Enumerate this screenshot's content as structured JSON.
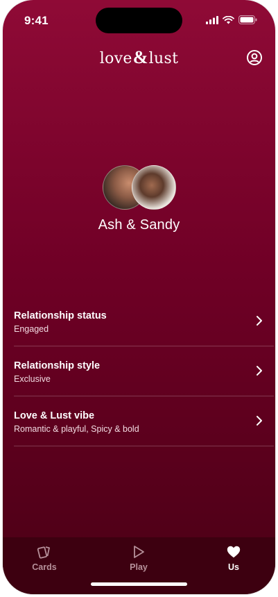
{
  "status_bar": {
    "time": "9:41"
  },
  "header": {
    "logo_left": "love",
    "logo_amp": "&",
    "logo_right": "lust"
  },
  "couple": {
    "names": "Ash & Sandy"
  },
  "settings": [
    {
      "title": "Relationship status",
      "value": "Engaged"
    },
    {
      "title": "Relationship style",
      "value": "Exclusive"
    },
    {
      "title": "Love & Lust vibe",
      "value": "Romantic & playful, Spicy & bold"
    }
  ],
  "tabs": [
    {
      "label": "Cards",
      "icon": "cards-icon"
    },
    {
      "label": "Play",
      "icon": "play-icon"
    },
    {
      "label": "Us",
      "icon": "heart-icon",
      "active": true
    }
  ],
  "colors": {
    "background_top": "#8f0a36",
    "background_bottom": "#4a0015",
    "tabbar": "#3d0010"
  }
}
